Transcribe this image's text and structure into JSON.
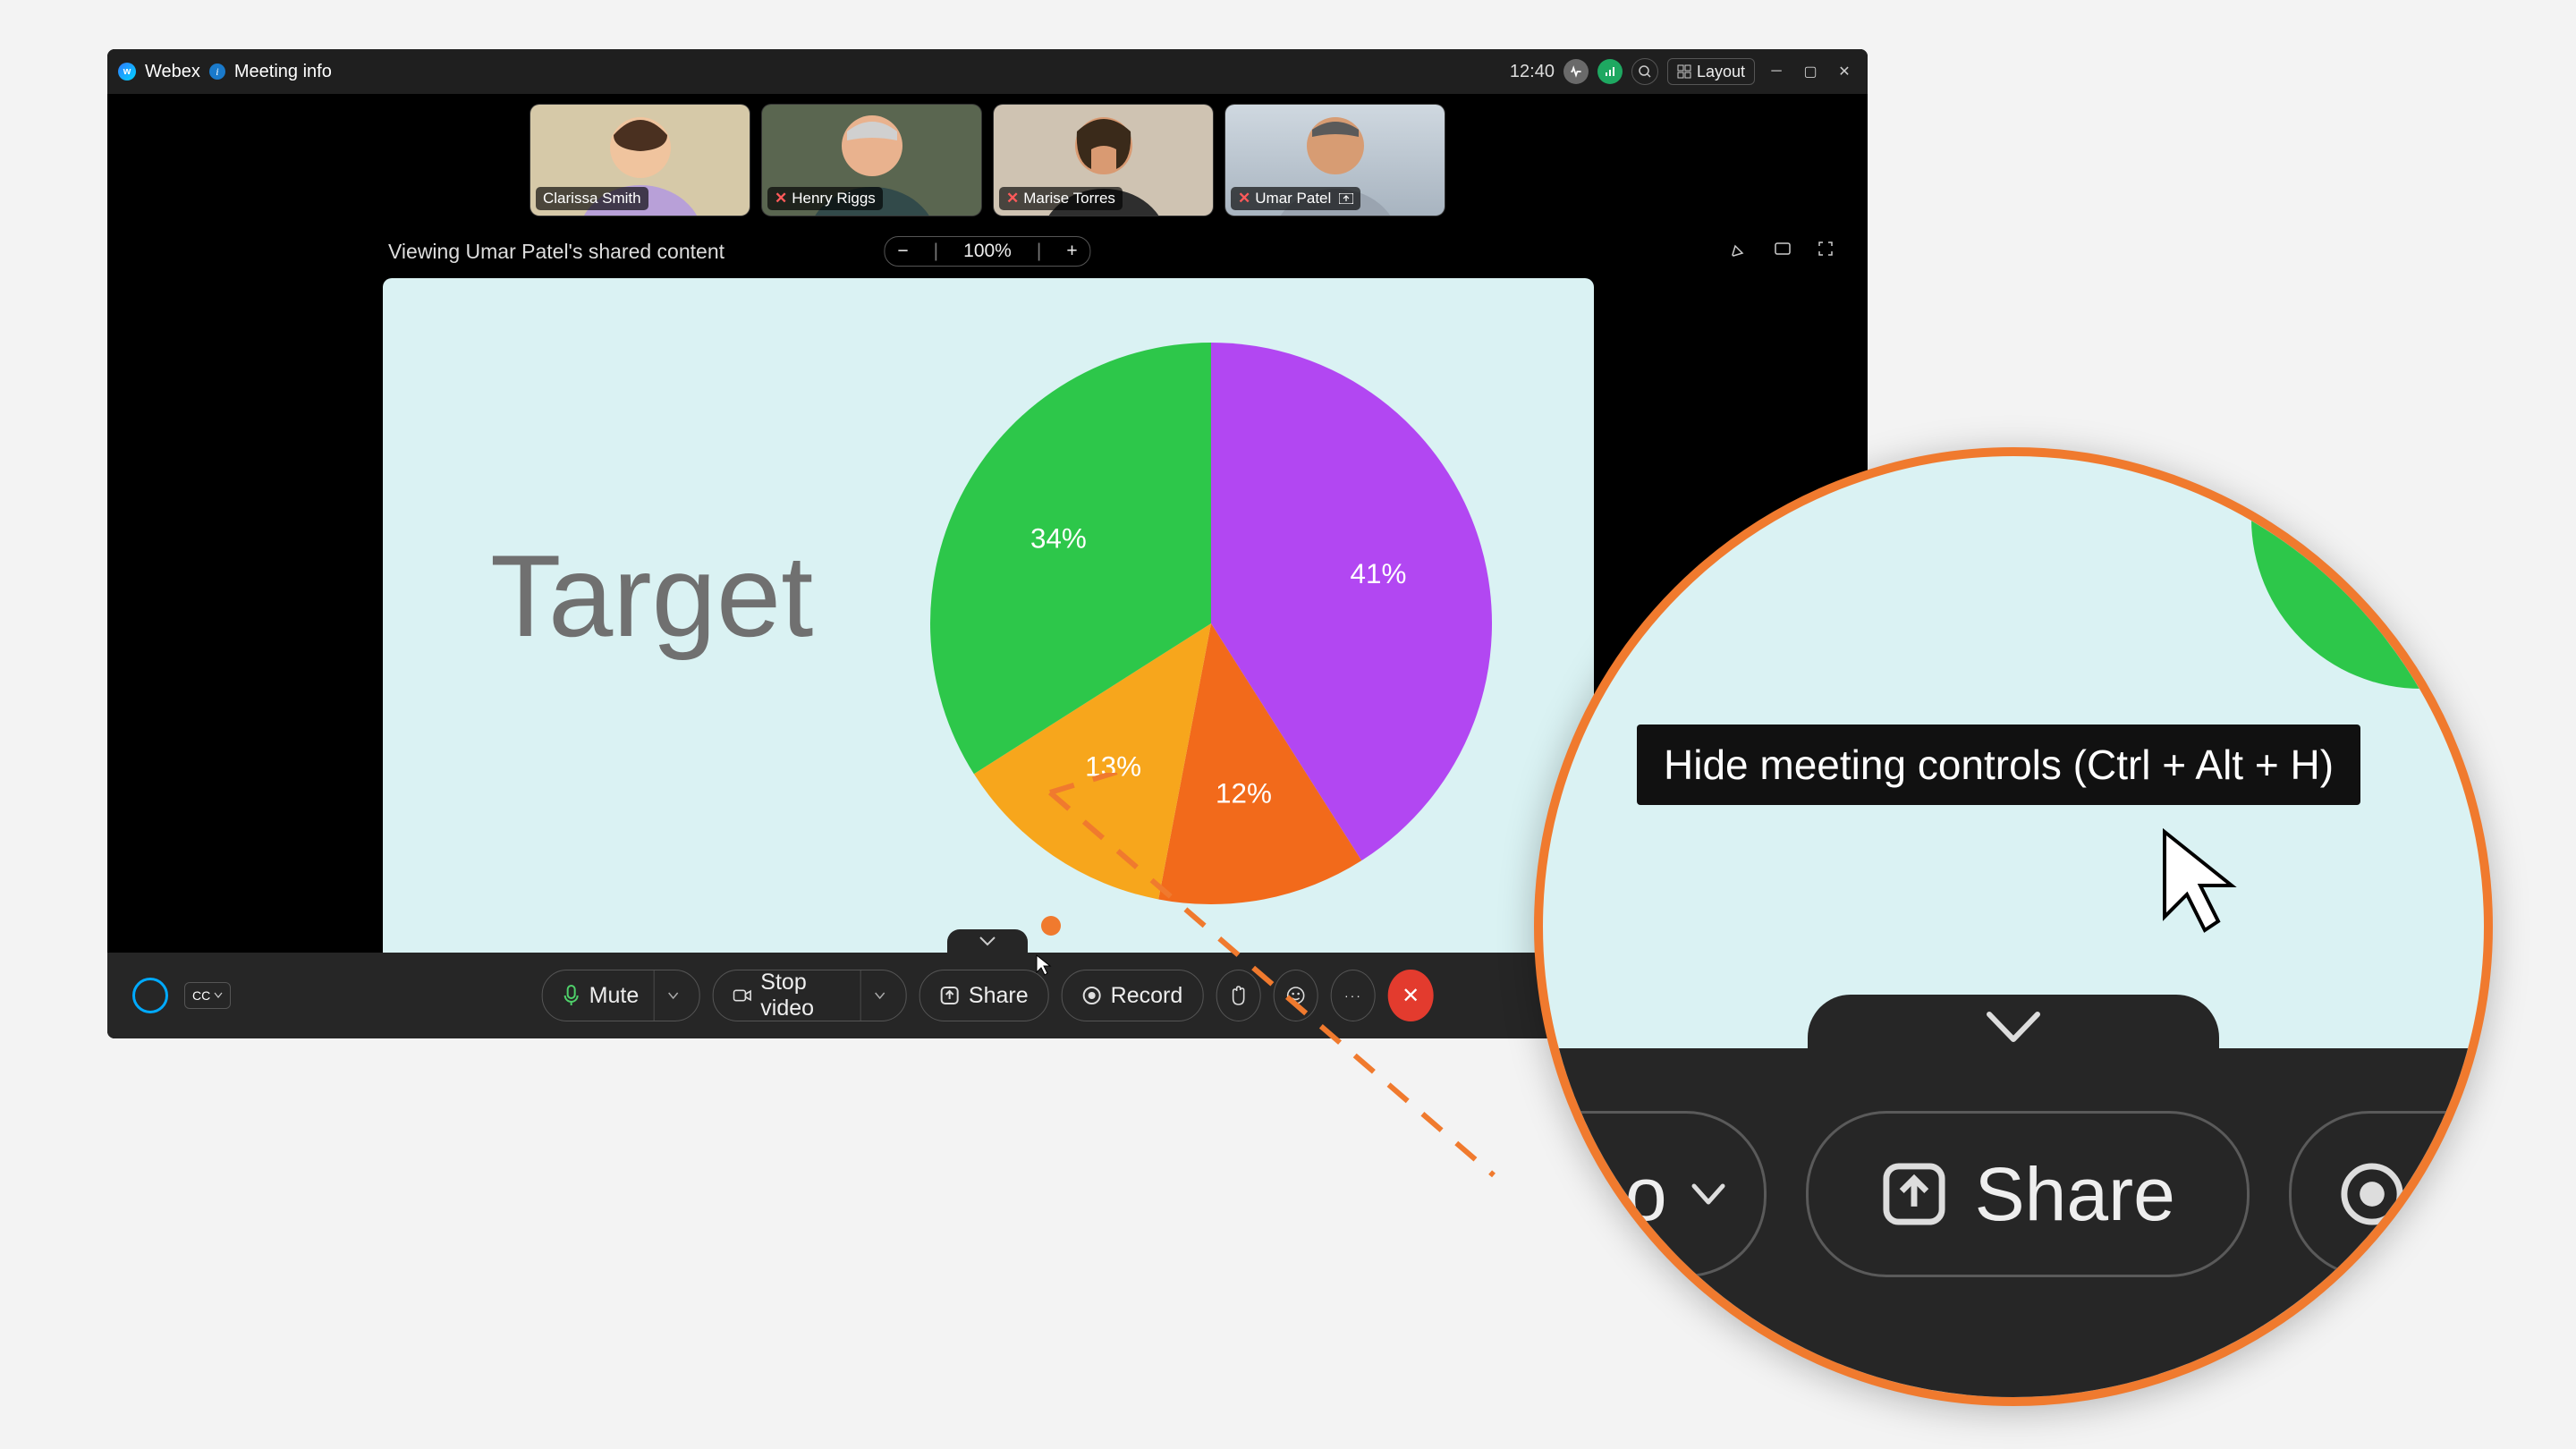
{
  "titlebar": {
    "app_name": "Webex",
    "meeting_info": "Meeting info",
    "time": "12:40",
    "layout_label": "Layout"
  },
  "participants": [
    {
      "name": "Clarissa Smith",
      "muted": false,
      "bg": "#d6c9a8",
      "skin": "#f0c49e",
      "top": "#b8a0d8"
    },
    {
      "name": "Henry Riggs",
      "muted": true,
      "bg": "#5a6650",
      "skin": "#e9b28e",
      "top": "#324a4a"
    },
    {
      "name": "Marise Torres",
      "muted": true,
      "bg": "#cfc3b2",
      "skin": "#d99a72",
      "top": "#2e2e2e"
    },
    {
      "name": "Umar Patel",
      "muted": true,
      "bg": "#c7d0d8",
      "skin": "#d79c73",
      "top": "#9aa4b0",
      "presenting": true
    }
  ],
  "viewing_label": "Viewing Umar Patel's shared content",
  "zoom": {
    "minus": "−",
    "value": "100%",
    "plus": "+"
  },
  "shared_content": {
    "title": "Target"
  },
  "chart_data": {
    "type": "pie",
    "title": "Target",
    "series": [
      {
        "label": "41%",
        "value": 41,
        "color": "#b247f2"
      },
      {
        "label": "12%",
        "value": 12,
        "color": "#f26a1b"
      },
      {
        "label": "13%",
        "value": 13,
        "color": "#f7a61c"
      },
      {
        "label": "34%",
        "value": 34,
        "color": "#2dc74a"
      }
    ]
  },
  "toolbar": {
    "mute_label": "Mute",
    "stop_video_label": "Stop video",
    "share_label": "Share",
    "record_label": "Record",
    "cc_label": "CC"
  },
  "magnifier": {
    "tooltip": "Hide meeting controls (Ctrl + Alt + H)",
    "partial_left": "eo",
    "share_label": "Share"
  }
}
